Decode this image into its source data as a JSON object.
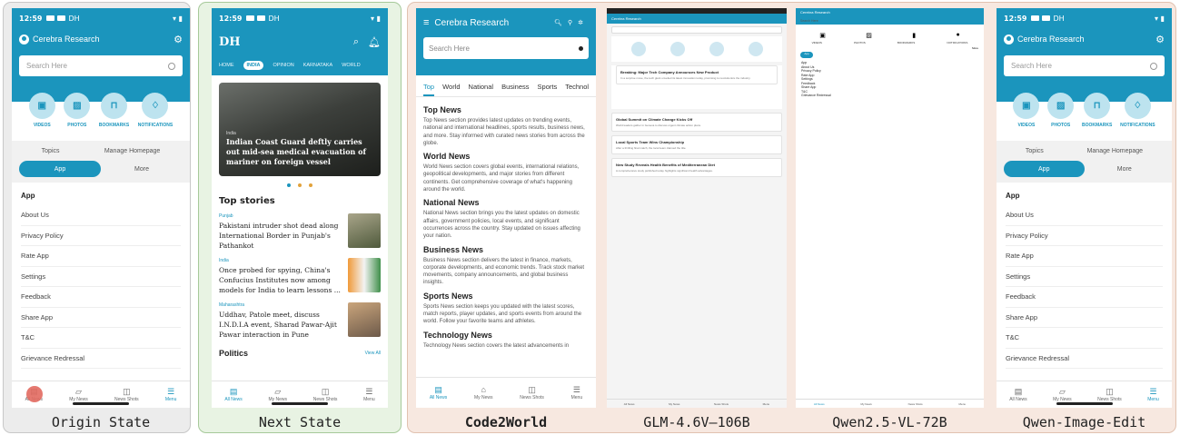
{
  "labels": {
    "origin": "Origin State",
    "next": "Next State",
    "code2world": "Code2World",
    "glm": "GLM-4.6V—106B",
    "qwen_vl": "Qwen2.5-VL-72B",
    "qwen_edit": "Qwen-Image-Edit"
  },
  "status": {
    "time": "12:59",
    "tags": "DH"
  },
  "cerebra": {
    "brand": "Cerebra Research",
    "search_placeholder": "Search Here",
    "quick": [
      "VIDEOS",
      "PHOTOS",
      "BOOKMARKS",
      "NOTIFICATIONS"
    ],
    "tab_labels": [
      "Topics",
      "Manage Homepage"
    ],
    "segments": [
      "App",
      "More"
    ],
    "menu_head": "App",
    "menu": [
      "About Us",
      "Privacy Policy",
      "Rate App",
      "Settings",
      "Feedback",
      "Share App",
      "T&C",
      "Grievance Redressal"
    ],
    "bottom_nav": [
      "All News",
      "My News",
      "News Shots",
      "Menu"
    ]
  },
  "dh": {
    "logo": "DH",
    "nav": [
      "HOME",
      "INDIA",
      "OPINION",
      "KARNATAKA",
      "WORLD"
    ],
    "hero_cat": "India",
    "hero_title": "Indian Coast Guard deftly carries out mid-sea medical evacuation of mariner on foreign vessel",
    "section": "Top stories",
    "stories": [
      {
        "cat": "Punjab",
        "headline": "Pakistani intruder shot dead along International Border in Punjab's Pathankot"
      },
      {
        "cat": "India",
        "headline": "Once probed for spying, China's Confucius Institutes now among models for India to learn lessons ..."
      },
      {
        "cat": "Maharashtra",
        "headline": "Uddhav, Patole meet, discuss I.N.D.I.A event, Sharad Pawar-Ajit Pawar interaction in Pune"
      }
    ],
    "politics": "Politics",
    "view_all": "View All"
  },
  "c2w": {
    "brand": "Cerebra Research",
    "search": "Search Here",
    "tabs": [
      "Top",
      "World",
      "National",
      "Business",
      "Sports",
      "Technol"
    ],
    "sections": [
      {
        "title": "Top News",
        "text": "Top News section provides latest updates on trending events, national and international headlines, sports results, business news, and more. Stay informed with curated news stories from across the globe."
      },
      {
        "title": "World News",
        "text": "World News section covers global events, international relations, geopolitical developments, and major stories from different continents. Get comprehensive coverage of what's happening around the world."
      },
      {
        "title": "National News",
        "text": "National News section brings you the latest updates on domestic affairs, government policies, local events, and significant occurrences across the country. Stay updated on issues affecting your nation."
      },
      {
        "title": "Business News",
        "text": "Business News section delivers the latest in finance, markets, corporate developments, and economic trends. Track stock market movements, company announcements, and global business insights."
      },
      {
        "title": "Sports News",
        "text": "Sports News section keeps you updated with the latest scores, match reports, player updates, and sports events from around the world. Follow your favorite teams and athletes."
      },
      {
        "title": "Technology News",
        "text": "Technology News section covers the latest advancements in"
      }
    ],
    "bottom_nav": [
      "All News",
      "My News",
      "News Shots",
      "Menu"
    ]
  },
  "glm": {
    "title": "Cerebra Research",
    "cards": [
      {
        "t": "Breaking: Major Tech Company Announces New Product",
        "d": "In a surprise move, the tech giant unveiled its latest innovation today, promising to revolutionize the industry."
      },
      {
        "t": "Global Summit on Climate Change Kicks Off",
        "d": "World leaders gather in Geneva to discuss urgent climate action plans."
      },
      {
        "t": "Local Sports Team Wins Championship",
        "d": "After a thrilling final match, the local team claimed the title."
      },
      {
        "t": "New Study Reveals Health Benefits of Mediterranean Diet",
        "d": "A comprehensive study published today highlights significant health advantages."
      }
    ]
  },
  "qwenvl": {
    "title": "Cerebra Research",
    "search": "Search Here",
    "icons": [
      "VIDEOS",
      "PHOTOS",
      "BOOKMARKS",
      "NOTIFICATIONS"
    ],
    "more": "More",
    "app": "App",
    "menu": [
      "App",
      "About Us",
      "Privacy Policy",
      "Rate App",
      "Settings",
      "Feedback",
      "Share App",
      "T&C",
      "Grievance Redressal"
    ],
    "nav": [
      "All News",
      "My News",
      "News Shots",
      "Menu"
    ]
  }
}
